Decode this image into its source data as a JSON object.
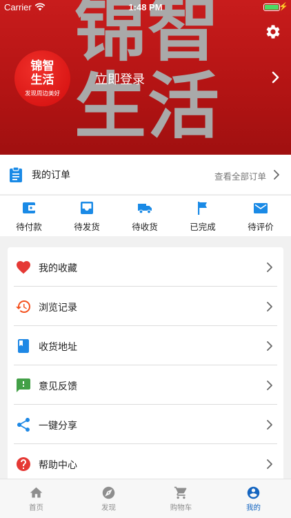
{
  "status_bar": {
    "carrier": "Carrier",
    "time": "1:48 PM",
    "battery_color": "#4cd964"
  },
  "header": {
    "bg_chars": [
      "锦智",
      "生活"
    ],
    "logo": {
      "line1": "锦智",
      "line2": "生活",
      "tagline": "发现周边美好"
    },
    "login_label": "立即登录",
    "bg_color": "#c1191a",
    "icons": {
      "settings": "gear-icon",
      "chevron": "chevron-right-icon"
    }
  },
  "orders": {
    "title": "我的订单",
    "view_all": "查看全部订单",
    "accent": "#1a8ae6",
    "statuses": [
      {
        "label": "待付款",
        "icon": "wallet-icon"
      },
      {
        "label": "待发货",
        "icon": "inbox-icon"
      },
      {
        "label": "待收货",
        "icon": "truck-icon"
      },
      {
        "label": "已完成",
        "icon": "flag-icon"
      },
      {
        "label": "待评价",
        "icon": "mail-icon"
      }
    ]
  },
  "menu": [
    {
      "label": "我的收藏",
      "icon": "heart-icon",
      "color": "#e53935"
    },
    {
      "label": "浏览记录",
      "icon": "history-icon",
      "color": "#f4511e"
    },
    {
      "label": "收货地址",
      "icon": "book-icon",
      "color": "#1e88e5"
    },
    {
      "label": "意见反馈",
      "icon": "feedback-icon",
      "color": "#43a047"
    },
    {
      "label": "一键分享",
      "icon": "share-icon",
      "color": "#1e88e5"
    },
    {
      "label": "帮助中心",
      "icon": "help-icon",
      "color": "#e53935"
    }
  ],
  "tabbar": {
    "active_color": "#1565c0",
    "tabs": [
      {
        "label": "首页",
        "icon": "home-icon",
        "active": false
      },
      {
        "label": "发现",
        "icon": "compass-icon",
        "active": false
      },
      {
        "label": "购物车",
        "icon": "cart-icon",
        "active": false
      },
      {
        "label": "我的",
        "icon": "account-icon",
        "active": true
      }
    ]
  }
}
